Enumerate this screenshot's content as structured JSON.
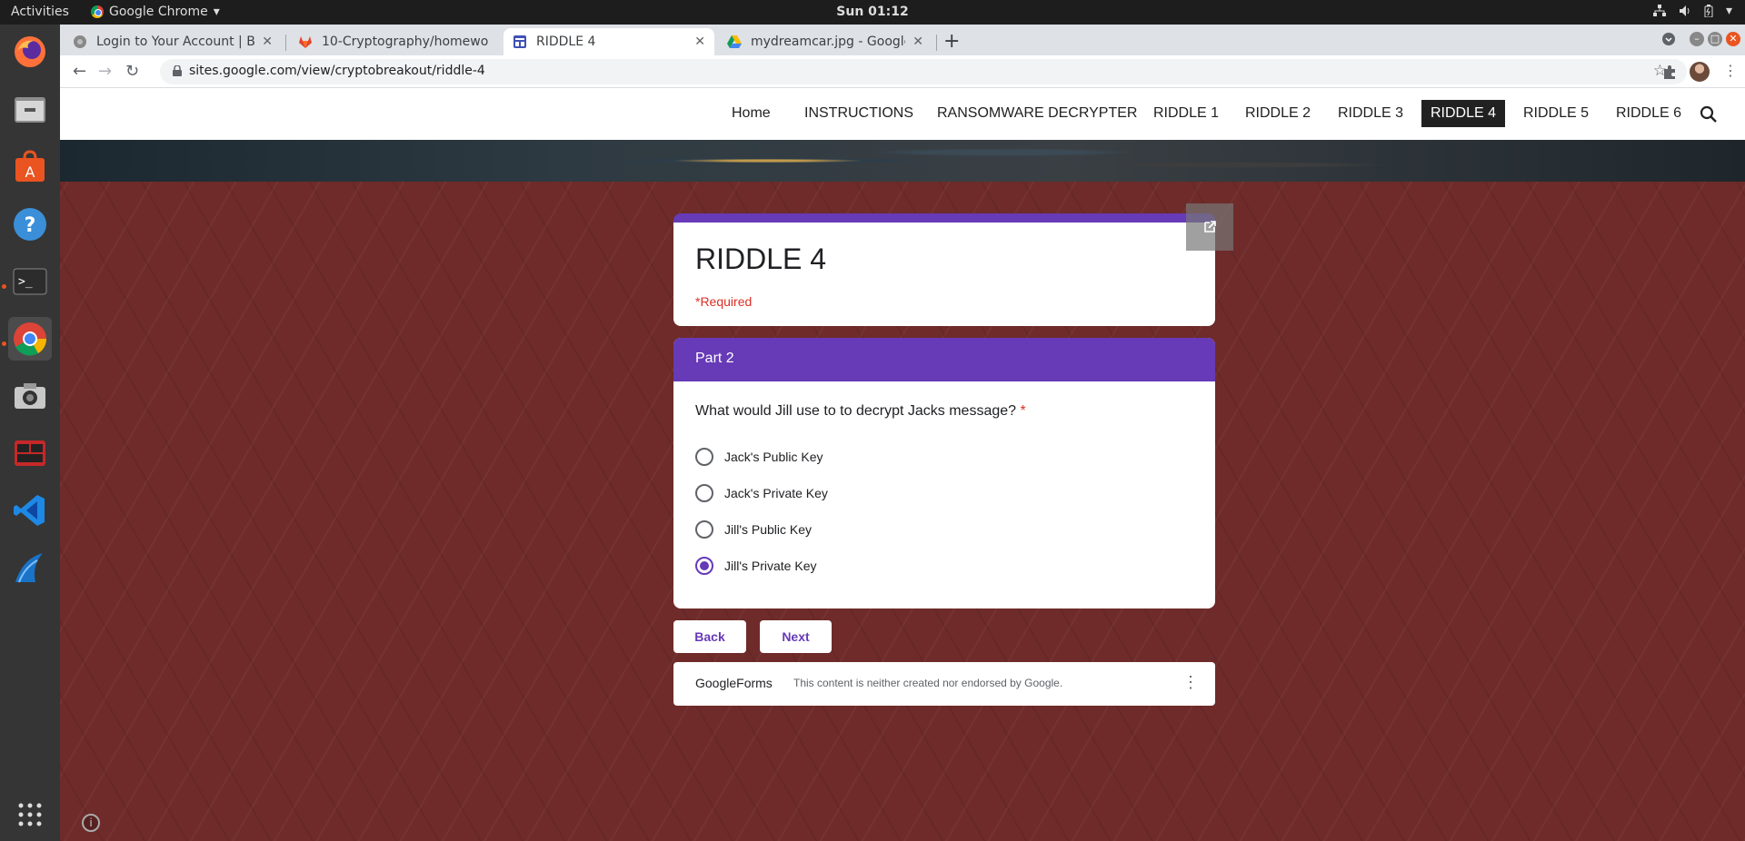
{
  "topbar": {
    "activities": "Activities",
    "app": "Google Chrome",
    "clock": "Sun 01:12"
  },
  "tabs": [
    {
      "label": "Login to Your Account | B",
      "icon": "globe-icon"
    },
    {
      "label": "10-Cryptography/homewo",
      "icon": "gitlab-icon"
    },
    {
      "label": "RIDDLE 4",
      "icon": "google-sites-icon",
      "active": true
    },
    {
      "label": "mydreamcar.jpg - Google",
      "icon": "google-drive-icon"
    }
  ],
  "address": {
    "url": "sites.google.com/view/cryptobreakout/riddle-4"
  },
  "site_nav": {
    "items": [
      "Home",
      "INSTRUCTIONS",
      "RANSOMWARE DECRYPTER",
      "RIDDLE 1",
      "RIDDLE 2",
      "RIDDLE 3",
      "RIDDLE 4",
      "RIDDLE 5",
      "RIDDLE 6"
    ],
    "current": "RIDDLE 4"
  },
  "form": {
    "title": "RIDDLE 4",
    "required_note": "*Required",
    "section_title": "Part 2",
    "question": "What would Jill use to to decrypt Jacks message?",
    "required_star": "*",
    "options": [
      "Jack's Public Key",
      "Jack's Private Key",
      "Jill's Public Key",
      "Jill's Private Key"
    ],
    "selected": "Jill's Private Key",
    "back_label": "Back",
    "next_label": "Next",
    "footer_brand": "GoogleForms",
    "footer_note": "This content is neither created nor endorsed by Google."
  },
  "colors": {
    "accent": "#673ab7",
    "required": "#d93025",
    "background": "#6e2b2a"
  }
}
